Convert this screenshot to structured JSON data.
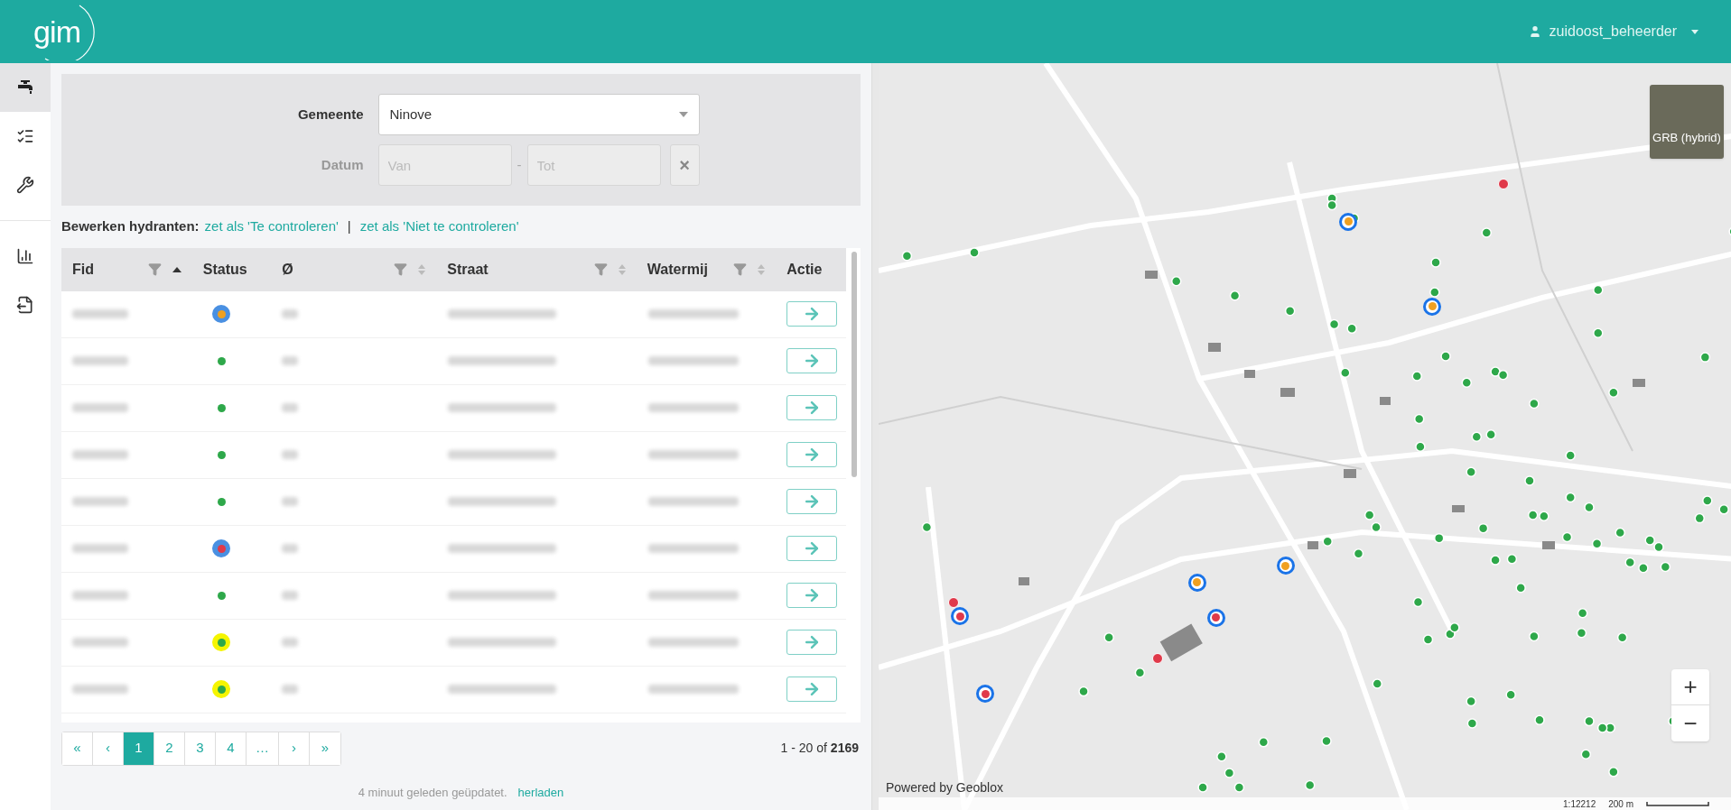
{
  "header": {
    "logo": "gim",
    "user": "zuidoost_beheerder"
  },
  "sidebar": {
    "items": [
      {
        "kind": "tap",
        "selected": true
      },
      {
        "kind": "checklist",
        "selected": false
      },
      {
        "kind": "tools",
        "selected": false
      },
      {
        "kind": "chart",
        "selected": false
      },
      {
        "kind": "export",
        "selected": false
      }
    ]
  },
  "filter": {
    "gemeente_label": "Gemeente",
    "gemeente_value": "Ninove",
    "datum_label": "Datum",
    "van_placeholder": "Van",
    "separator": "-",
    "tot_placeholder": "Tot",
    "clear": "×"
  },
  "bulk_edit": {
    "label": "Bewerken hydranten:",
    "actions": [
      "zet als 'Te controleren'",
      "zet als 'Niet te controleren'"
    ],
    "separator": "|"
  },
  "table": {
    "columns": [
      {
        "label": "Fid",
        "filter": true,
        "sortable": true,
        "sorted_ascending": true
      },
      {
        "label": "Status",
        "filter": false,
        "sortable": false
      },
      {
        "label": "Ø",
        "filter": true,
        "sortable": true,
        "sorted_ascending": false
      },
      {
        "label": "Straat",
        "filter": true,
        "sortable": true,
        "sorted_ascending": false
      },
      {
        "label": "Watermij",
        "filter": true,
        "sortable": true,
        "sorted_ascending": false
      },
      {
        "label": "Actie",
        "filter": false,
        "sortable": false
      }
    ],
    "rows": [
      {
        "color": "#f0a020",
        "kind": "ringed"
      },
      {
        "color": "#2ea84a",
        "kind": "plain"
      },
      {
        "color": "#2ea84a",
        "kind": "plain"
      },
      {
        "color": "#2ea84a",
        "kind": "plain"
      },
      {
        "color": "#2ea84a",
        "kind": "plain"
      },
      {
        "color": "#e0394a",
        "kind": "ringed"
      },
      {
        "color": "#2ea84a",
        "kind": "plain"
      },
      {
        "color": "#2ea84a",
        "kind": "flagged"
      },
      {
        "color": "#2ea84a",
        "kind": "flagged"
      }
    ]
  },
  "pagination": {
    "pages": [
      {
        "label": "«",
        "selected": false
      },
      {
        "label": "‹",
        "selected": false
      },
      {
        "label": "1",
        "selected": true
      },
      {
        "label": "2",
        "selected": false
      },
      {
        "label": "3",
        "selected": false
      },
      {
        "label": "4",
        "selected": false
      },
      {
        "label": "…",
        "selected": false
      },
      {
        "label": "›",
        "selected": false
      },
      {
        "label": "»",
        "selected": false
      }
    ],
    "range": "1 - 20 of",
    "total": "2169"
  },
  "footer": {
    "updated": "4 minuut geleden geüpdatet.",
    "reload": "herladen"
  },
  "map": {
    "basemap": "GRB (hybrid)",
    "zoom_in": "+",
    "zoom_out": "−",
    "attribution": "Powered by Geoblox",
    "scale_ratio": "1:12212",
    "scale_distance": "200 m",
    "markers": [
      {
        "color": "#f0a020",
        "ring": true
      },
      {
        "color": "#f0a020",
        "ring": true
      },
      {
        "color": "#f0a020",
        "ring": true
      },
      {
        "color": "#f0a020",
        "ring": true
      },
      {
        "color": "#e0394a",
        "ring": true
      },
      {
        "color": "#e0394a",
        "ring": true
      },
      {
        "color": "#e0394a",
        "ring": true
      },
      {
        "color": "#e0394a",
        "ring": false
      },
      {
        "color": "#e0394a",
        "ring": false
      },
      {
        "color": "#e0394a",
        "ring": false
      }
    ]
  }
}
